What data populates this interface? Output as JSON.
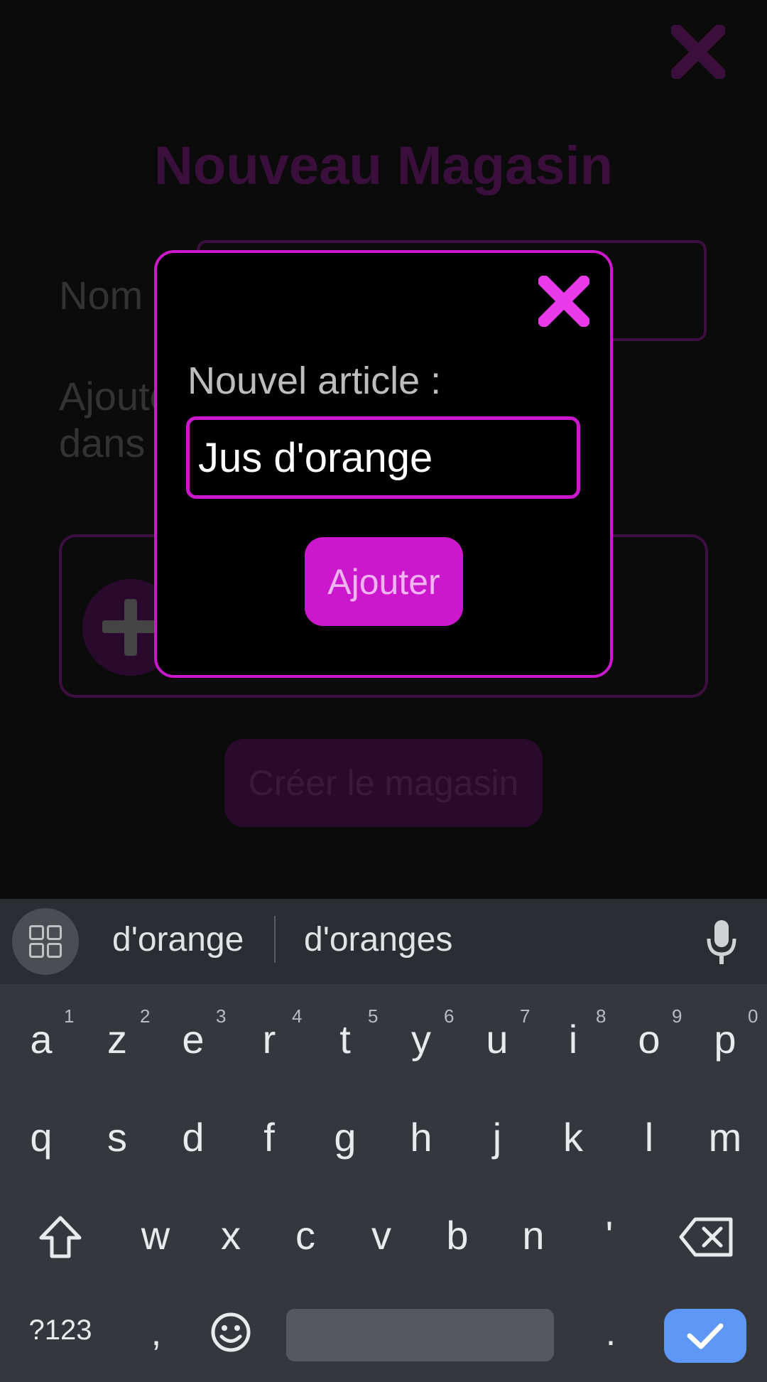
{
  "background": {
    "title": "Nouveau Magasin",
    "name_label": "Nom",
    "description": "Ajoutez les articles à acheter dans ce magasin",
    "create_button": "Créer le magasin"
  },
  "dialog": {
    "label": "Nouvel article :",
    "input_value": "Jus d'orange",
    "add_button": "Ajouter"
  },
  "keyboard": {
    "suggestions": [
      "d'orange",
      "d'oranges"
    ],
    "row1": [
      {
        "key": "a",
        "hint": "1"
      },
      {
        "key": "z",
        "hint": "2"
      },
      {
        "key": "e",
        "hint": "3"
      },
      {
        "key": "r",
        "hint": "4"
      },
      {
        "key": "t",
        "hint": "5"
      },
      {
        "key": "y",
        "hint": "6"
      },
      {
        "key": "u",
        "hint": "7"
      },
      {
        "key": "i",
        "hint": "8"
      },
      {
        "key": "o",
        "hint": "9"
      },
      {
        "key": "p",
        "hint": "0"
      }
    ],
    "row2": [
      "q",
      "s",
      "d",
      "f",
      "g",
      "h",
      "j",
      "k",
      "l",
      "m"
    ],
    "row3": [
      "w",
      "x",
      "c",
      "v",
      "b",
      "n",
      "'"
    ],
    "bottom": {
      "symbols": "?123",
      "comma": ",",
      "period": "."
    }
  },
  "colors": {
    "accent": "#cc18cc",
    "accent_dim": "#3a0f3c",
    "keyboard_bg": "#34383d",
    "enter_key": "#5e97f6"
  },
  "icons": [
    "close-icon",
    "dialog-close-icon",
    "plus-icon",
    "apps-grid-icon",
    "microphone-icon",
    "shift-icon",
    "backspace-icon",
    "emoji-icon",
    "checkmark-icon"
  ]
}
